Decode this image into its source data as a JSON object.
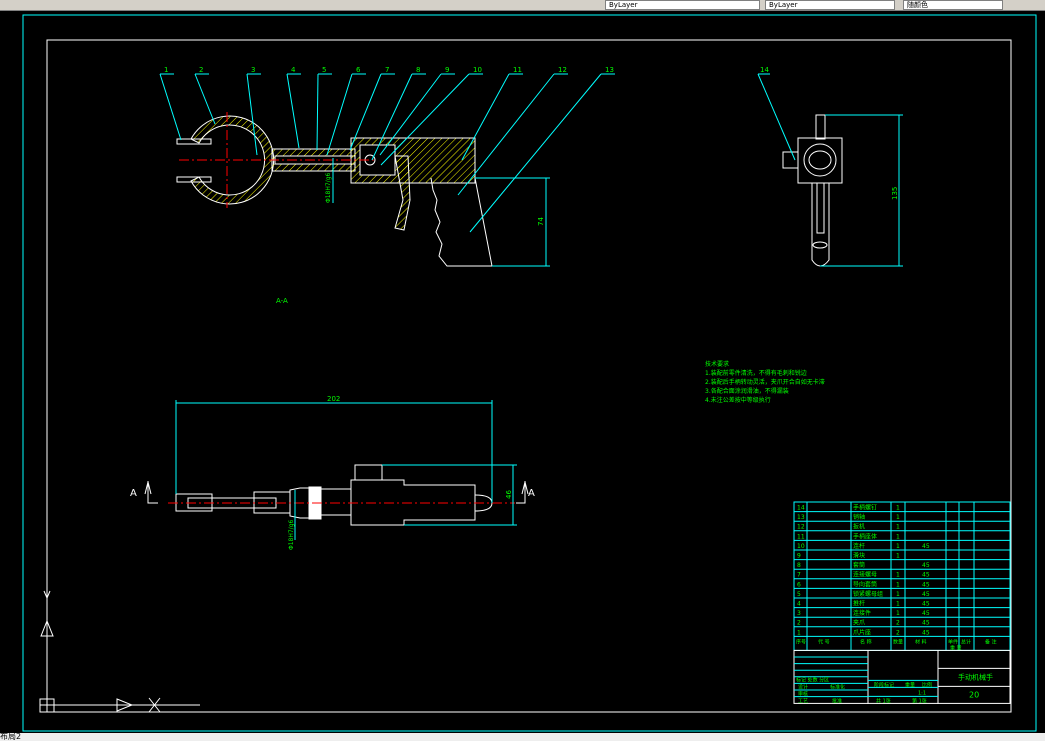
{
  "toolbar": {
    "fields": [
      "ByLayer",
      "ByLayer",
      "ByLayer",
      "随颜色"
    ]
  },
  "tabs": {
    "active": "布局2"
  },
  "colors": {
    "background": "#000000",
    "frame": "#ffffff",
    "border": "#00ffff",
    "text": "#00ff00",
    "hatch": "#ffff00",
    "centerline": "#ff0000",
    "dimension": "#00ffff"
  },
  "drawing": {
    "balloons": [
      "1",
      "2",
      "3",
      "4",
      "5",
      "6",
      "7",
      "8",
      "9",
      "10",
      "11",
      "12",
      "13",
      "14"
    ],
    "section_label": "A-A",
    "view_marker": "A",
    "dims": {
      "height_main": "74",
      "height_side": "135",
      "length": "202",
      "width": "46",
      "fit_upper": "Φ18H7/g6",
      "fit_lower": "Φ18H7/g6"
    },
    "notes": {
      "title": "技术要求",
      "lines": [
        "1.装配前零件清洗，不得有毛刺和锐边",
        "2.装配后手柄转动灵活，夹爪开合自如无卡滞",
        "3.各配合面涂润滑油，不得漏装",
        "4.未注公差按中等级执行"
      ]
    }
  },
  "bom": {
    "rows": [
      {
        "no": "14",
        "name": "手柄螺钉",
        "qty": "1",
        "material": ""
      },
      {
        "no": "13",
        "name": "销轴",
        "qty": "1",
        "material": ""
      },
      {
        "no": "12",
        "name": "扳机",
        "qty": "1",
        "material": ""
      },
      {
        "no": "11",
        "name": "手柄座体",
        "qty": "1",
        "material": ""
      },
      {
        "no": "10",
        "name": "连杆",
        "qty": "1",
        "material": "45"
      },
      {
        "no": "9",
        "name": "滑块",
        "qty": "1",
        "material": ""
      },
      {
        "no": "8",
        "name": "套筒",
        "qty": "",
        "material": "45"
      },
      {
        "no": "7",
        "name": "连接螺母",
        "qty": "1",
        "material": "45"
      },
      {
        "no": "6",
        "name": "导向套筒",
        "qty": "1",
        "material": "45"
      },
      {
        "no": "5",
        "name": "锁紧螺母组",
        "qty": "1",
        "material": "45"
      },
      {
        "no": "4",
        "name": "推杆",
        "qty": "1",
        "material": "45"
      },
      {
        "no": "3",
        "name": "连接件",
        "qty": "1",
        "material": "45"
      },
      {
        "no": "2",
        "name": "夹爪",
        "qty": "2",
        "material": "45"
      },
      {
        "no": "1",
        "name": "爪片座",
        "qty": "2",
        "material": "45"
      }
    ],
    "header": {
      "no": "序号",
      "code": "代 号",
      "name": "名 称",
      "qty": "数量",
      "material": "材 料",
      "single": "单件",
      "total": "总计",
      "weight": "重 量",
      "remark": "备 注"
    },
    "title_block": {
      "designer": "设计",
      "checker": "审核",
      "process": "工艺",
      "stage": "阶段标记",
      "weight": "重量",
      "scale": "比例",
      "sheets": "共 1张",
      "sheet": "第 1张",
      "scale_value": "1:1",
      "drawing_name": "手动机械手",
      "drawing_no": "20",
      "revise": "标记 处数 分区",
      "standard": "标准化",
      "approve": "批准"
    }
  }
}
